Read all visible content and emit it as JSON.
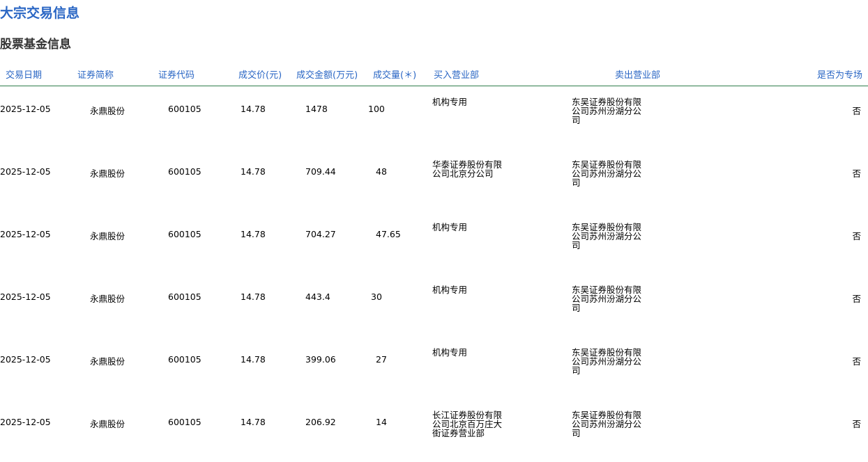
{
  "page": {
    "title": "大宗交易信息",
    "section_title": "股票基金信息"
  },
  "table": {
    "columns": [
      "交易日期",
      "证券简称",
      "证券代码",
      "成交价(元)",
      "成交金额(万元)",
      "成交量(＊)",
      "买入营业部",
      "卖出营业部",
      "是否为专场"
    ],
    "rows": [
      [
        "2025-12-05",
        "永鼎股份",
        "600105",
        "14.78",
        "1478",
        "100",
        "机构专用",
        "东吴证券股份有限公司苏州汾湖分公司",
        "否"
      ],
      [
        "2025-12-05",
        "永鼎股份",
        "600105",
        "14.78",
        "709.44",
        "48",
        "华泰证券股份有限公司北京分公司",
        "东吴证券股份有限公司苏州汾湖分公司",
        "否"
      ],
      [
        "2025-12-05",
        "永鼎股份",
        "600105",
        "14.78",
        "704.27",
        "47.65",
        "机构专用",
        "东吴证券股份有限公司苏州汾湖分公司",
        "否"
      ],
      [
        "2025-12-05",
        "永鼎股份",
        "600105",
        "14.78",
        "443.4",
        "30",
        "机构专用",
        "东吴证券股份有限公司苏州汾湖分公司",
        "否"
      ],
      [
        "2025-12-05",
        "永鼎股份",
        "600105",
        "14.78",
        "399.06",
        "27",
        "机构专用",
        "东吴证券股份有限公司苏州汾湖分公司",
        "否"
      ],
      [
        "2025-12-05",
        "永鼎股份",
        "600105",
        "14.78",
        "206.92",
        "14",
        "长江证券股份有限公司北京百万庄大街证券营业部",
        "东吴证券股份有限公司苏州汾湖分公司",
        "否"
      ]
    ]
  }
}
